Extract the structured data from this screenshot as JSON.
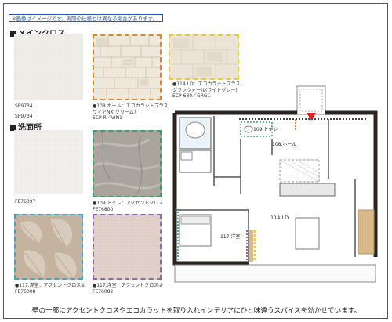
{
  "notice": "※画像はイメージです。実際の仕様とは異なる場合があります。",
  "sections": {
    "main_cross": "メインクロス",
    "washroom": "洗面所"
  },
  "swatches": [
    {
      "code": "SP9734",
      "caption_lines": [
        "SP9734"
      ]
    },
    {
      "code": "108",
      "caption_lines": [
        "●108.ホール：エコカラットプラス",
        "ヴィアNX(クリーム)",
        "ECP-R／VIN1"
      ],
      "border": "#d9892a"
    },
    {
      "code": "114",
      "caption_lines": [
        "●114.LD：エコカラットプラス",
        "グランウォール(ライトグレー)",
        "ECP-630／GRG1"
      ],
      "border": "#e8c93a"
    },
    {
      "code": "FE76397",
      "caption_lines": [
        "FE76397"
      ]
    },
    {
      "code": "109",
      "caption_lines": [
        "●109.トイレ：アクセントクロス",
        "FE76800"
      ],
      "border": "#3aa06a"
    },
    {
      "code": "117a",
      "caption_lines": [
        "●117.洋室：アクセントクロス①",
        "FE76008"
      ],
      "border": "#3fa7c9"
    },
    {
      "code": "117b",
      "caption_lines": [
        "●117.洋室：アクセントクロス②",
        "FE76082"
      ],
      "border": "#8a6ab3"
    }
  ],
  "extra_caption": "SP9734",
  "floorplan": {
    "room_108": "108.ホール",
    "room_109": "109.トイレ",
    "room_114": "114.LD",
    "room_117": "117.洋室"
  },
  "footer": "壁の一部にアクセントクロスやエコカラットを取り入れインテリアにひと味違うスパイスを効かせています。",
  "colors": {
    "notice_blue": "#2b5aa8",
    "wall_dark": "#2a2320",
    "wood": "#d9b98a",
    "red_marker": "#e02020"
  }
}
